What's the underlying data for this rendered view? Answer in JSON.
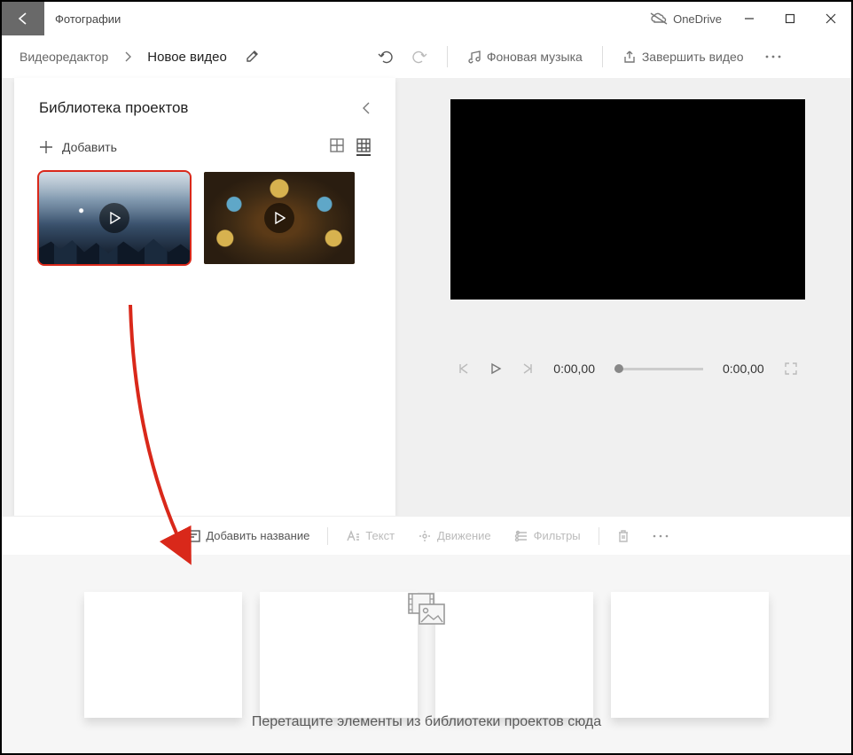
{
  "titlebar": {
    "app_title": "Фотографии",
    "onedrive_label": "OneDrive"
  },
  "toolbar": {
    "breadcrumb_root": "Видеоредактор",
    "project_title": "Новое видео",
    "bg_music_label": "Фоновая музыка",
    "finish_label": "Завершить видео"
  },
  "library": {
    "panel_title": "Библиотека проектов",
    "add_label": "Добавить"
  },
  "player": {
    "time_current": "0:00,00",
    "time_total": "0:00,00"
  },
  "storyboard": {
    "add_title_label": "Добавить название",
    "text_label": "Текст",
    "motion_label": "Движение",
    "filters_label": "Фильтры"
  },
  "dropzone": {
    "hint": "Перетащите элементы из библиотеки проектов сюда"
  }
}
